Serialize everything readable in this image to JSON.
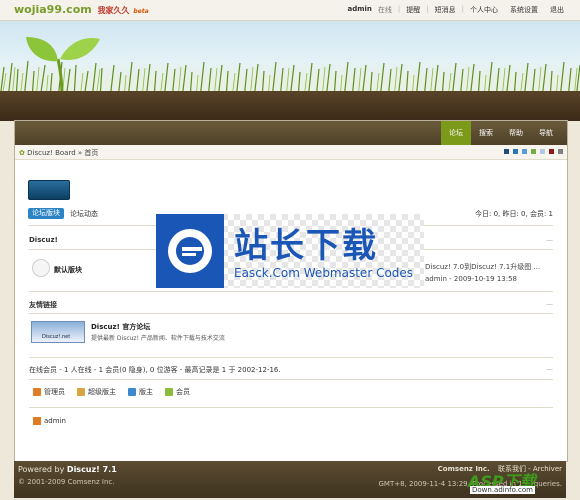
{
  "topbar": {
    "logo_main": "wojia99.com",
    "logo_cn": "我家久久",
    "logo_beta": "beta",
    "user": "admin",
    "status": "在线",
    "links": [
      "提醒",
      "短消息",
      "个人中心",
      "系统设置",
      "退出"
    ]
  },
  "nav": {
    "tabs": [
      "论坛",
      "搜索",
      "帮助",
      "导航"
    ],
    "active": "论坛"
  },
  "breadcrumb": "Discuz! Board » 首页",
  "colors": {
    "accent": "#7c9a1a",
    "nav_bg": "#4e4128",
    "link_blue": "#2c84c4",
    "swatches": [
      "#1f4e79",
      "#2e75b6",
      "#5b9bd5",
      "#70ad47",
      "#b4c7e7",
      "#8b1a1a",
      "#7f7f7f"
    ]
  },
  "toolbar": {
    "new_posts_button": "论坛版块",
    "forum_activity": "论坛动态",
    "stats": "今日: 0, 昨日: 0, 会员: 1"
  },
  "category": {
    "title": "Discuz!",
    "forum_name": "默认版块",
    "last_post_title": "Discuz! 7.0到Discuz! 7.1升级图 ...",
    "last_post_meta": "admin - 2009-10-19 13:58"
  },
  "friend_links": {
    "title": "友情链接",
    "banner_text": "Discuz!.net",
    "name": "Discuz! 官方论坛",
    "desc": "提供最新 Discuz! 产品新闻、软件下载与技术交流"
  },
  "online": {
    "text": "在线会员 - 1 人在线 - 1 会员(0 隐身), 0 位游客 - 最高记录是 1 于 2002-12-16.",
    "legend": [
      {
        "label": "管理员",
        "icon": "admin-icon"
      },
      {
        "label": "超级版主",
        "icon": "super-moderator-icon"
      },
      {
        "label": "版主",
        "icon": "moderator-icon"
      },
      {
        "label": "会员",
        "icon": "member-icon"
      }
    ],
    "user": "admin"
  },
  "footer": {
    "powered_prefix": "Powered by",
    "powered_name": "Discuz! 7.1",
    "copyright": "© 2001-2009 Comsenz Inc.",
    "company": "Comsenz Inc.",
    "links": "联系我们 - Archiver",
    "timing": "GMT+8, 2009-11-4 13:29, Processed in 1.... queries."
  },
  "watermark": {
    "title_cn": "站长下载",
    "title_en": "Easck.Com Webmaster Codes"
  },
  "corner_logo": {
    "text": "ASP下载",
    "url": "Down.adinfo.com"
  }
}
